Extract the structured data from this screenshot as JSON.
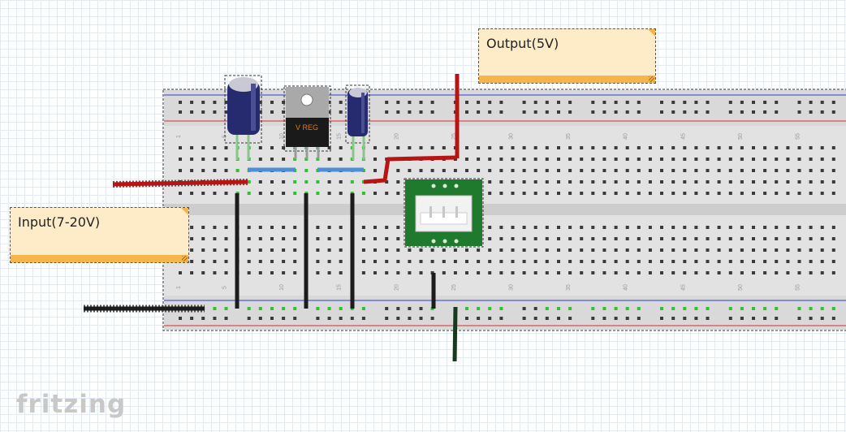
{
  "app": {
    "logo": "fritzing"
  },
  "notes": {
    "output": {
      "text": "Output(5V)"
    },
    "input": {
      "text": "Input(7-20V)"
    }
  },
  "breadboard": {
    "column_labels": [
      "1",
      "5",
      "10",
      "15",
      "20",
      "25",
      "30",
      "35",
      "40",
      "45",
      "50",
      "55"
    ],
    "colors": {
      "body": "#e2e2e2",
      "hole": "#3a3a3a",
      "rail_red": "#d23030",
      "rail_blue": "#3040d0",
      "connected": "#2fc22f"
    }
  },
  "components": {
    "regulator": {
      "label": "V REG"
    },
    "capacitor_large": {
      "color": "#262a6e"
    },
    "capacitor_small": {
      "color": "#262a6e"
    },
    "connector": {
      "color": "#1f7a2e"
    }
  },
  "wires": {
    "colors": {
      "red": "#b81414",
      "black": "#1c1c1c",
      "blue": "#4a8fd8",
      "dark_green": "#173a1c"
    }
  }
}
